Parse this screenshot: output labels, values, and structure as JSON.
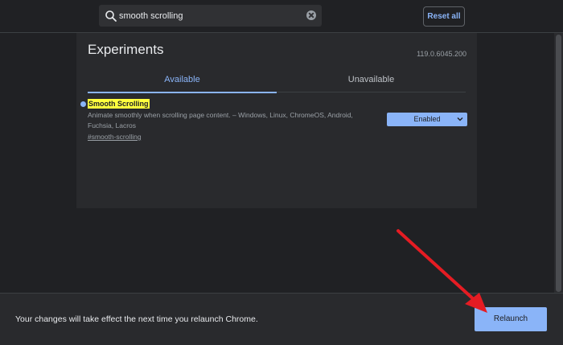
{
  "header": {
    "search": {
      "value": "smooth scrolling",
      "placeholder": "Search flags"
    },
    "reset_label": "Reset all"
  },
  "panel": {
    "title": "Experiments",
    "version": "119.0.6045.200",
    "tabs": [
      {
        "label": "Available",
        "active": true
      },
      {
        "label": "Unavailable",
        "active": false
      }
    ],
    "flag": {
      "name": "Smooth Scrolling",
      "description": "Animate smoothly when scrolling page content. – Windows, Linux, ChromeOS, Android, Fuchsia, Lacros",
      "link": "#smooth-scrolling",
      "selected_option": "Enabled"
    }
  },
  "bottom_bar": {
    "message": "Your changes will take effect the next time you relaunch Chrome.",
    "relaunch_label": "Relaunch"
  },
  "colors": {
    "accent": "#8ab4f8",
    "background": "#202124",
    "panel": "#292a2d",
    "highlight": "#ffff3e",
    "annotation_arrow": "#e51c23"
  },
  "icons": {
    "search": "search-icon",
    "clear": "clear-icon",
    "dropdown": "chevron-down-icon"
  }
}
